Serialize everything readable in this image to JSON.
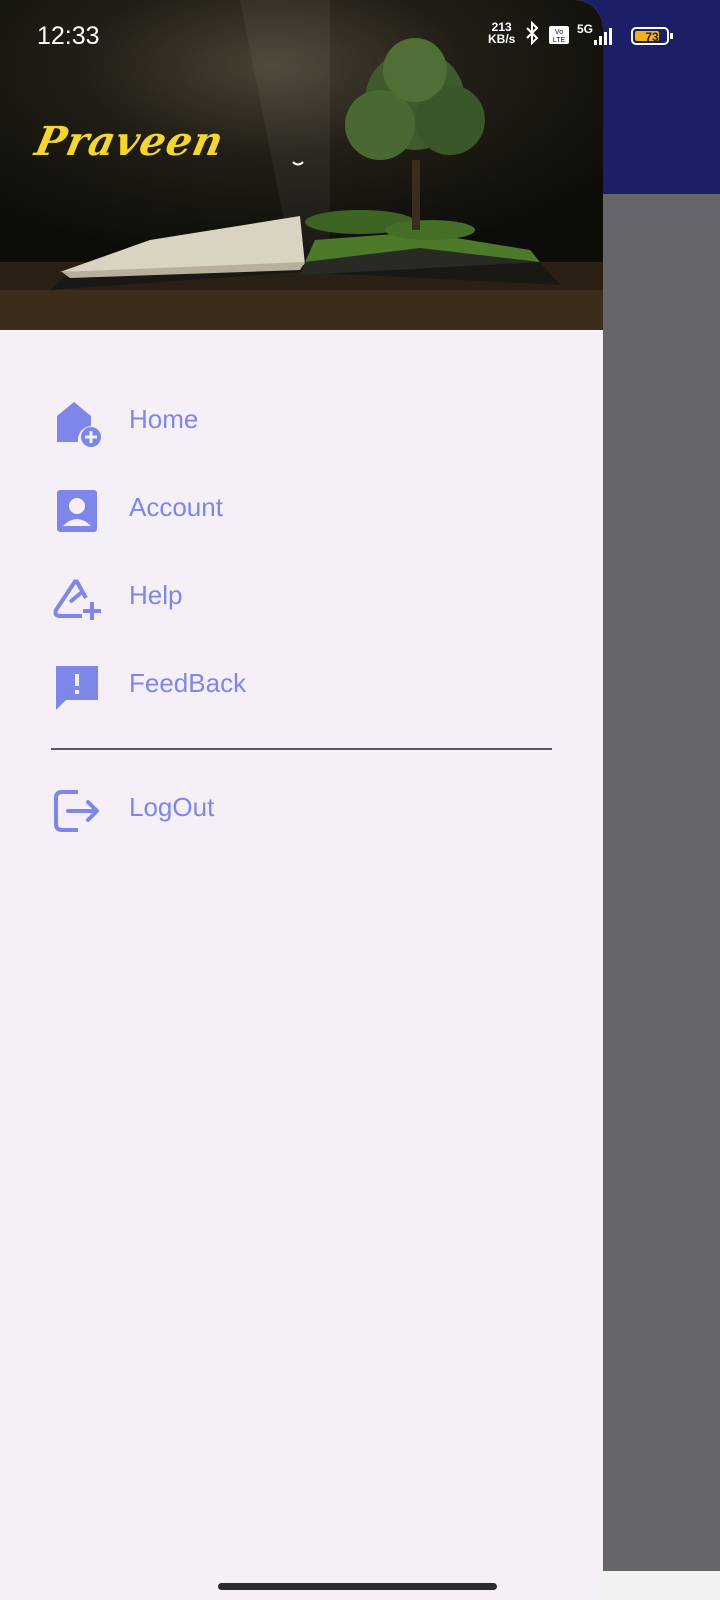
{
  "status_bar": {
    "time": "12:33",
    "net_speed_value": "213",
    "net_speed_unit": "KB/s",
    "network": "5G",
    "volte": "Vo LTE",
    "battery": "73"
  },
  "drawer": {
    "header_name": "Praveen",
    "menu_items": [
      {
        "label": "Home",
        "icon": "home-add-icon"
      },
      {
        "label": "Account",
        "icon": "account-box-icon"
      },
      {
        "label": "Help",
        "icon": "help-plus-icon"
      },
      {
        "label": "FeedBack",
        "icon": "feedback-icon"
      }
    ],
    "logout": {
      "label": "LogOut",
      "icon": "logout-icon"
    }
  },
  "colors": {
    "accent": "#7e87e9",
    "drawer_bg": "#f5eff8",
    "toolbar": "#1b1f66",
    "brand_text": "#f4d531"
  }
}
